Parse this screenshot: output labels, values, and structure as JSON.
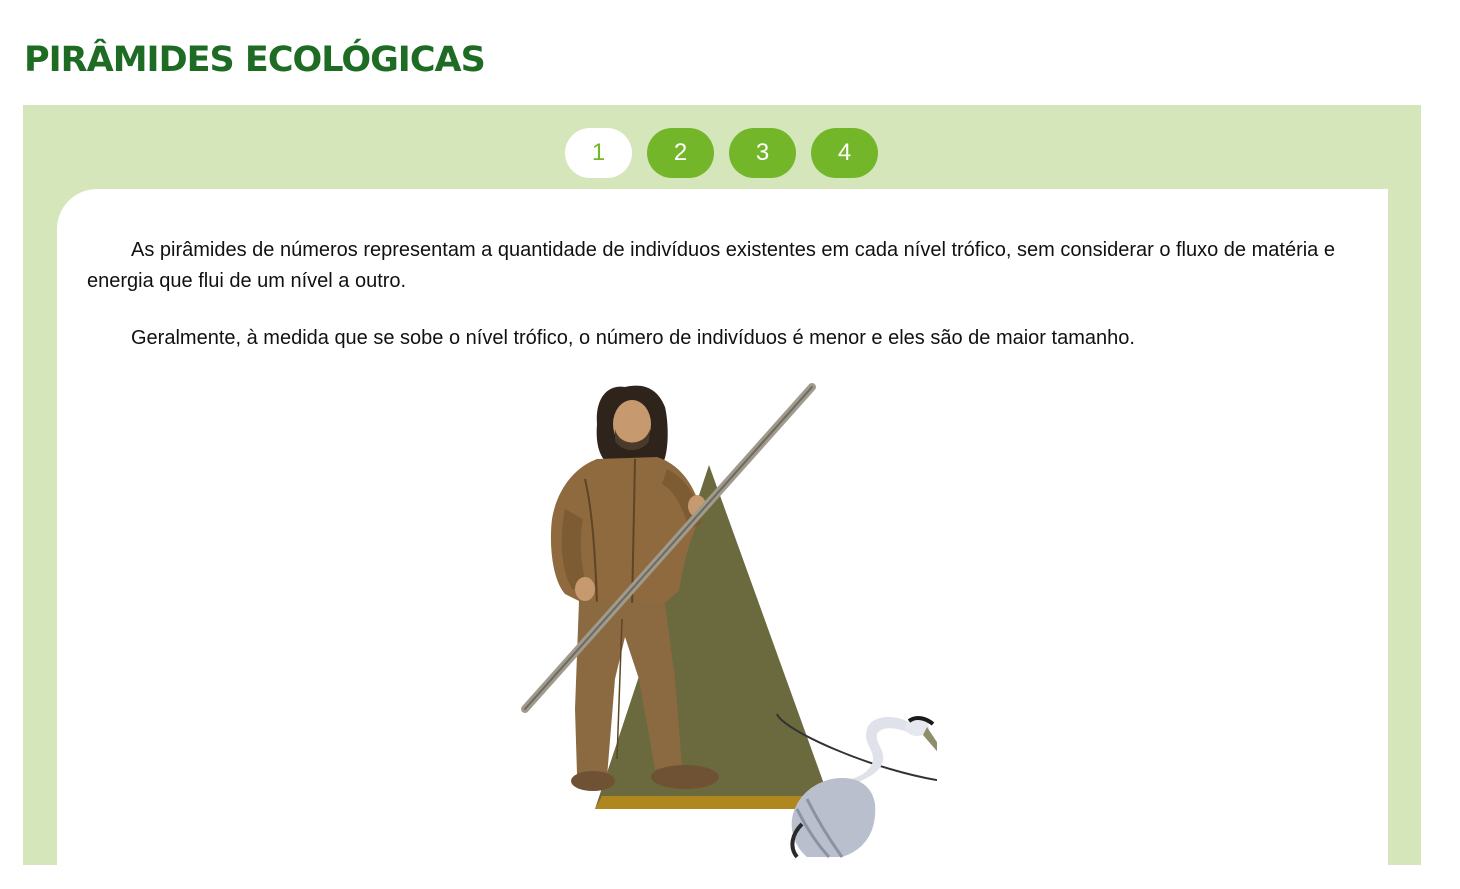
{
  "page": {
    "title": "PIRÂMIDES ECOLÓGICAS"
  },
  "pagination": {
    "pages": [
      "1",
      "2",
      "3",
      "4"
    ],
    "active": "1"
  },
  "content": {
    "paragraph_1": "As pirâmides de números representam a quantidade de indivíduos existentes em cada nível trófico, sem considerar o fluxo de matéria e energia que flui de um nível a outro.",
    "paragraph_2": "Geralmente, à medida que se sobe o nível trófico, o número de indivíduos é menor e eles são de maior tamanho."
  },
  "colors": {
    "title": "#1e6b24",
    "panel_background": "#d5e6bb",
    "page_button": "#74b62a",
    "pyramid_top": "#6b6a3f",
    "pyramid_base": "#b0861e"
  },
  "illustration": {
    "icons": [
      "human-figure-icon",
      "heron-icon",
      "pyramid-icon"
    ]
  }
}
